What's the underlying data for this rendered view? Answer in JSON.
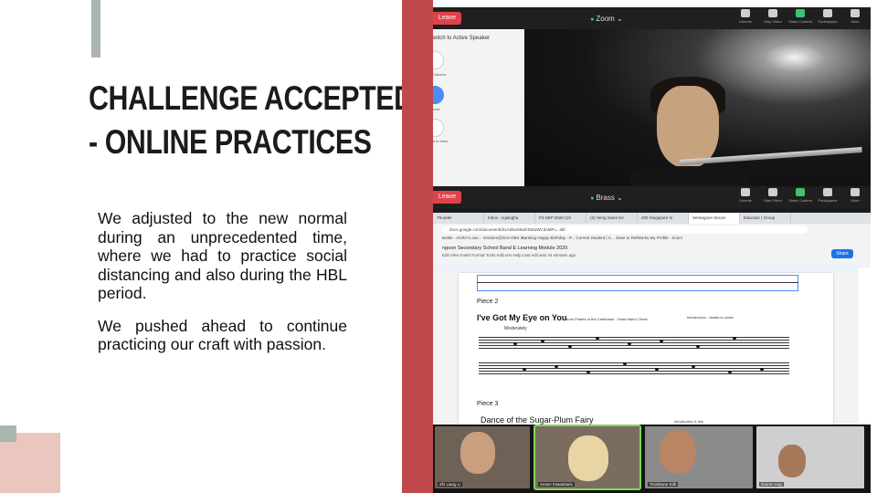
{
  "slide": {
    "title_line1": "CHALLENGE ACCEPTED",
    "title_line2": "- ONLINE PRACTICES",
    "paragraphs": [
      "We adjusted to the new normal during an unprecedented time, where we had to practice social distancing and also during the HBL period.",
      "We pushed ahead to continue practicing our craft with passion."
    ],
    "colors": {
      "red_stripe": "#c0484a",
      "grey_accent": "#aab5b0",
      "pink_accent": "#e9c7bf"
    }
  },
  "screenshot": {
    "zoom_top": {
      "leave_label": "Leave",
      "meeting_label": "Zoom",
      "switch_view_label": "witch to Active Speaker",
      "side_labels": [
        "Camera",
        "ooth",
        "k to\nView"
      ],
      "tools": [
        {
          "icon": "mic-icon",
          "label": "Unmute"
        },
        {
          "icon": "video-icon",
          "label": "Stop Video"
        },
        {
          "icon": "share-icon",
          "label": "Share Content"
        },
        {
          "icon": "participants-icon",
          "label": "Participants"
        },
        {
          "icon": "more-icon",
          "label": "More"
        }
      ]
    },
    "zoom_bottom": {
      "leave_label": "Leave",
      "meeting_label": "Brass",
      "tools": [
        {
          "icon": "mic-icon",
          "label": "Unmute"
        },
        {
          "icon": "video-icon",
          "label": "Start Video"
        },
        {
          "icon": "share-icon",
          "label": "Share Content"
        },
        {
          "icon": "participants-icon",
          "label": "Participants"
        },
        {
          "icon": "more-icon",
          "label": "More"
        }
      ]
    },
    "browser": {
      "tabs": [
        "Thunder",
        "Inbox - zqiangha",
        "P3 SEP 2020 (19",
        "(2) Heng Swee Ke",
        "400 Singapore m",
        "Serangoon Secon",
        "Educator | Group"
      ],
      "active_tab": 5,
      "address": "docs.google.com/document/d/1Ad4wSkubiTaSoWCdoMFu...Idit",
      "bookmarks": "Bottle - ACRA's one... Vendors@Gov DBS iBanking Happy Birthday - P... Current Student | C... Save to RefWorks My Profile - Zoom",
      "doc_title": "ngoon Secondary School Band E Learning Module 2020",
      "menu": "Edit  View  Insert  Format  Tools  Add-ons  Help   Last edit was 44 minutes ago",
      "share_label": "Share",
      "piece2_label": "Piece 2",
      "song2_title": "I've Got My Eye on You",
      "song2_sub": "from Pirates of the Caribbean - Dead Man's Chest",
      "tempo": "Moderately",
      "intro_label": "Introduction - beads to clown",
      "piece3_label": "Piece 3",
      "song3_title": "Dance of the Sugar-Plum Fairy",
      "sub3": "Introduction & lets"
    },
    "gallery": [
      {
        "name": "Zhi Liang Li"
      },
      {
        "name": "Ansen Imasetiaris"
      },
      {
        "name": "Trombone Kith"
      },
      {
        "name": "Darren Ang"
      }
    ]
  }
}
